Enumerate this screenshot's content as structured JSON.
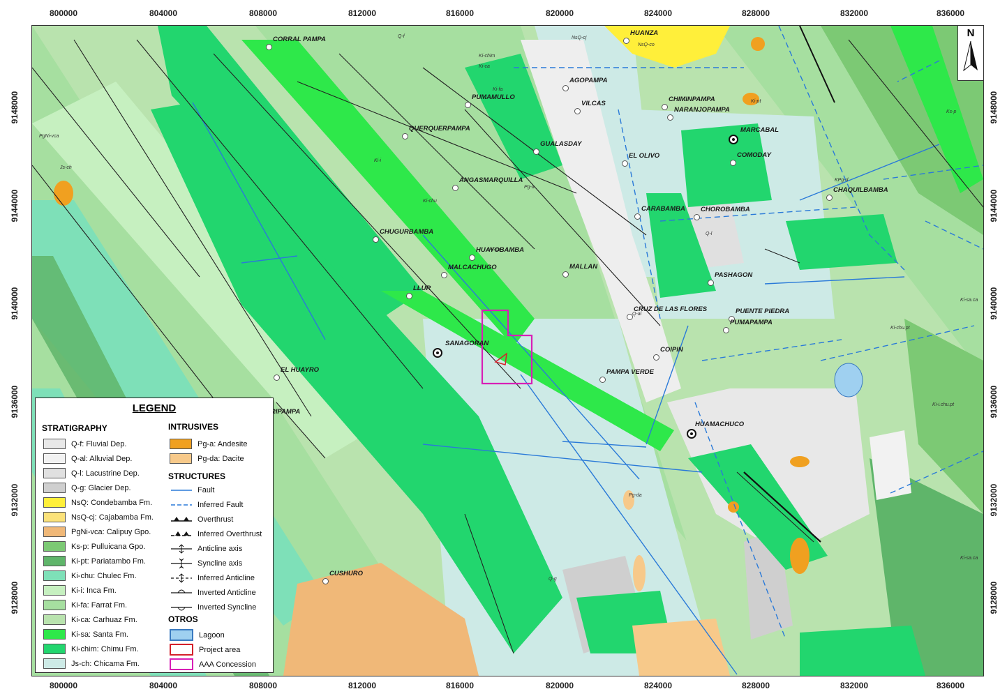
{
  "map": {
    "x_ticks": [
      "800000",
      "804000",
      "808000",
      "812000",
      "816000",
      "820000",
      "824000",
      "828000",
      "832000",
      "836000"
    ],
    "y_ticks": [
      "9148000",
      "9144000",
      "9140000",
      "9136000",
      "9132000",
      "9128000"
    ],
    "north_label": "N"
  },
  "places": [
    {
      "name": "HUANZA"
    },
    {
      "name": "CORRAL PAMPA"
    },
    {
      "name": "AGOPAMPA"
    },
    {
      "name": "PUMAMULLO"
    },
    {
      "name": "VILCAS"
    },
    {
      "name": "CHIMINPAMPA"
    },
    {
      "name": "NARANJOPAMPA"
    },
    {
      "name": "QUERQUERPAMPA"
    },
    {
      "name": "MARCABAL"
    },
    {
      "name": "GUALASDAY"
    },
    {
      "name": "COMODAY"
    },
    {
      "name": "EL OLIVO"
    },
    {
      "name": "ANGASMARQUILLA"
    },
    {
      "name": "CHAQUILBAMBA"
    },
    {
      "name": "CARABAMBA"
    },
    {
      "name": "CHOROBAMBA"
    },
    {
      "name": "CHUGURBAMBA"
    },
    {
      "name": "HUAYOBAMBA"
    },
    {
      "name": "PASHAGON"
    },
    {
      "name": "MALCACHUGO"
    },
    {
      "name": "MALLAN"
    },
    {
      "name": "LLUR"
    },
    {
      "name": "CRUZ DE LAS FLORES"
    },
    {
      "name": "PUENTE PIEDRA"
    },
    {
      "name": "PUMAPAMPA"
    },
    {
      "name": "SANAGORAN"
    },
    {
      "name": "COIPIN"
    },
    {
      "name": "EL HUAYRO"
    },
    {
      "name": "PAMPA VERDE"
    },
    {
      "name": "HUAMACHUCO"
    },
    {
      "name": "CUSHURO"
    },
    {
      "name": "RRIPAMPA"
    }
  ],
  "unit_labels": [
    "Q-f",
    "NsQ-cj",
    "NsQ-co",
    "Ki-chim",
    "Ki-ca",
    "Ki-fa",
    "Ki-i",
    "Ki-chu",
    "Ki-sa",
    "Js-ch",
    "Pg-a",
    "Ki-pt",
    "Ks-p",
    "PgNi-vca",
    "Q-al",
    "Q-l",
    "Q-g",
    "Pg-da",
    "KPg-d",
    "Ki-sa.ca",
    "Ki-chu.pt",
    "Ki-i.chu.pt",
    "Ki-sa.ca"
  ],
  "legend": {
    "title": "LEGEND",
    "stratigraphy_title": "STRATIGRAPHY",
    "intrusives_title": "INTRUSIVES",
    "structures_title": "STRUCTURES",
    "otros_title": "OTROS",
    "stratigraphy": [
      {
        "label": "Q-f: Fluvial Dep.",
        "color": "#e8e8e8"
      },
      {
        "label": "Q-al: Alluvial Dep.",
        "color": "#f2f2f2"
      },
      {
        "label": "Q-l: Lacustrine Dep.",
        "color": "#e0e0e0"
      },
      {
        "label": "Q-g: Glacier Dep.",
        "color": "#cfcfcf"
      },
      {
        "label": "NsQ: Condebamba Fm.",
        "color": "#ffef3a"
      },
      {
        "label": "NsQ-cj: Cajabamba Fm.",
        "color": "#fbe27a"
      },
      {
        "label": "PgNi-vca: Calipuy Gpo.",
        "color": "#f0b878"
      },
      {
        "label": "Ks-p: Pulluicana Gpo.",
        "color": "#7cc974"
      },
      {
        "label": "Ki-pt: Pariatambo Fm.",
        "color": "#5fb56a"
      },
      {
        "label": "Ki-chu: Chulec Fm.",
        "color": "#7ee0b8"
      },
      {
        "label": "Ki-i: Inca Fm.",
        "color": "#c6f0c0"
      },
      {
        "label": "Ki-fa: Farrat Fm.",
        "color": "#a6dfa0"
      },
      {
        "label": "Ki-ca: Carhuaz Fm.",
        "color": "#b9e3ae"
      },
      {
        "label": "Ki-sa: Santa Fm.",
        "color": "#2ee84a"
      },
      {
        "label": "Ki-chim: Chimu Fm.",
        "color": "#22d66e"
      },
      {
        "label": "Js-ch: Chicama Fm.",
        "color": "#cdeae6"
      }
    ],
    "intrusives": [
      {
        "label": "Pg-a: Andesite",
        "color": "#f0a020"
      },
      {
        "label": "Pg-da: Dacite",
        "color": "#f7c98a"
      }
    ],
    "structures": [
      {
        "label": "Fault",
        "symbol": "fault"
      },
      {
        "label": "Inferred Fault",
        "symbol": "inferred-fault"
      },
      {
        "label": "Overthrust",
        "symbol": "overthrust"
      },
      {
        "label": "Inferred Overthrust",
        "symbol": "inferred-overthrust"
      },
      {
        "label": "Anticline axis",
        "symbol": "anticline"
      },
      {
        "label": "Syncline axis",
        "symbol": "syncline"
      },
      {
        "label": "Inferred Anticline",
        "symbol": "inferred-anticline"
      },
      {
        "label": "Inverted Anticline",
        "symbol": "inverted-anticline"
      },
      {
        "label": "Inverted Syncline",
        "symbol": "inverted-syncline"
      }
    ],
    "otros": [
      {
        "label": "Lagoon",
        "color": "#9fd0f0",
        "border": "#3a7ac0"
      },
      {
        "label": "Project area",
        "color": "#ffffff",
        "border": "#d4202a"
      },
      {
        "label": "AAA Concession",
        "color": "#ffffff",
        "border": "#d81fb6"
      }
    ]
  }
}
